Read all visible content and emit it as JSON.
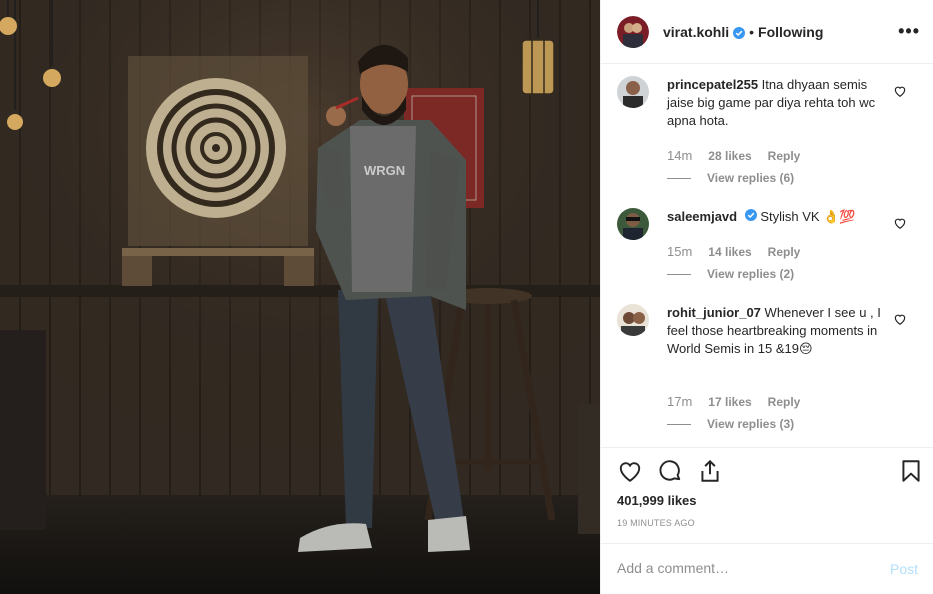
{
  "post": {
    "photo_alt": "Man holding a dart in front of a dartboard",
    "photo_brand_text": "WRGN"
  },
  "header": {
    "username": "virat.kohli",
    "separator": "•",
    "follow_label": "Following",
    "more_label": "•••"
  },
  "comments": [
    {
      "username": "princepatel255",
      "text": "Itna dhyaan semis jaise big game par diya rehta toh wc apna hota.",
      "time": "14m",
      "likes": "28 likes",
      "reply_label": "Reply",
      "view_replies": "View replies (6)"
    },
    {
      "username": "saleemjavd",
      "text": "Stylish VK 👌💯",
      "time": "15m",
      "likes": "14 likes",
      "reply_label": "Reply",
      "view_replies": "View replies (2)"
    },
    {
      "username": "rohit_junior_07",
      "text": "Whenever I see u , I feel those heartbreaking moments in World Semis in 15 &19😔",
      "time": "17m",
      "likes": "17 likes",
      "reply_label": "Reply",
      "view_replies": "View replies (3)"
    }
  ],
  "actions": {
    "like_icon": "heart-icon",
    "comment_icon": "comment-icon",
    "share_icon": "share-icon",
    "save_icon": "bookmark-icon",
    "likes_total": "401,999 likes",
    "posted_time": "19 MINUTES AGO"
  },
  "add_comment": {
    "placeholder": "Add a comment…",
    "post_label": "Post"
  },
  "colors": {
    "verified": "#3897f0",
    "muted": "#8e8e8e",
    "post_disabled": "#b2dffc",
    "border": "#efefef"
  }
}
